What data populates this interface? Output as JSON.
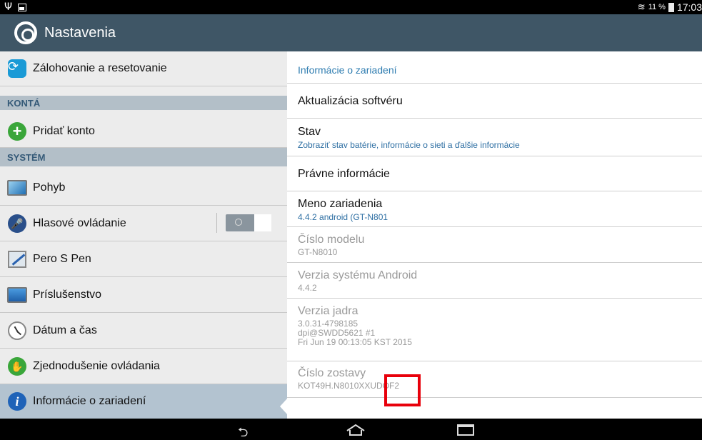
{
  "status": {
    "usb_icon": "usb-icon",
    "image_icon": "image-notification-icon",
    "wifi_icon": "wifi-icon",
    "battery_pct": "11 %",
    "time": "17:03"
  },
  "app": {
    "title": "Nastavenia",
    "icon": "settings-gear-icon"
  },
  "sidebar": {
    "items_top": [
      {
        "label": "Zálohovanie a resetovanie",
        "icon": "backup-icon"
      }
    ],
    "section_accounts": "KONTÁ",
    "add_account": "Pridať konto",
    "section_system": "SYSTÉM",
    "items_system": [
      {
        "label": "Pohyb",
        "icon": "motion-icon"
      },
      {
        "label": "Hlasové ovládanie",
        "icon": "voice-control-icon",
        "toggle": "off"
      },
      {
        "label": "Pero S Pen",
        "icon": "s-pen-icon"
      },
      {
        "label": "Príslušenstvo",
        "icon": "accessory-icon"
      },
      {
        "label": "Dátum a čas",
        "icon": "clock-icon"
      },
      {
        "label": "Zjednodušenie ovládania",
        "icon": "accessibility-icon"
      },
      {
        "label": "Informácie o zariadení",
        "icon": "info-icon",
        "selected": true
      }
    ]
  },
  "detail": {
    "header": "Informácie o zariadení",
    "software_update": "Aktualizácia softvéru",
    "status_title": "Stav",
    "status_sub": "Zobraziť stav batérie, informácie o sieti a ďalšie informácie",
    "legal": "Právne informácie",
    "device_name_title": "Meno zariadenia",
    "device_name_value": "4.4.2 android (GT-N801",
    "model_title": "Číslo modelu",
    "model_value": "GT-N8010",
    "android_title": "Verzia systému Android",
    "android_value": "4.4.2",
    "kernel_title": "Verzia jadra",
    "kernel_line1": "3.0.31-4798185",
    "kernel_line2": "dpi@SWDD5621 #1",
    "kernel_line3": "Fri Jun 19 00:13:05 KST 2015",
    "build_title": "Číslo zostavy",
    "build_value": "KOT49H.N8010XXUDOF2"
  },
  "colors": {
    "actionbar": "#3f5666",
    "accent": "#2e7cb0",
    "highlight": "#e8000b"
  },
  "navbar": {
    "back_icon": "back-icon",
    "home_icon": "home-icon",
    "recent_icon": "recent-apps-icon"
  }
}
